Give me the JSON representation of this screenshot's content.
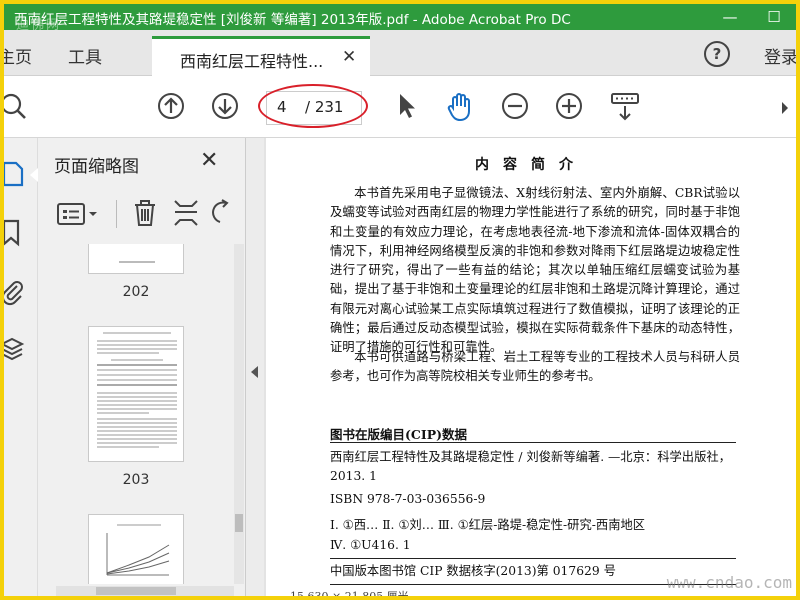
{
  "window": {
    "title": "西南红层工程特性及其路堤稳定性 [刘俊新 等编著] 2013年版.pdf - Adobe Acrobat Pro DC",
    "watermark": "迪佛网",
    "minimize": "—",
    "maximize": "☐"
  },
  "menu": {
    "home": "主页",
    "tools": "工具",
    "tab_label": "西南红层工程特性...",
    "tab_close": "✕",
    "help": "?",
    "sign_in": "登录"
  },
  "toolbar": {
    "page_current": "4",
    "page_total": "/ 231"
  },
  "thumbs": {
    "title": "页面缩略图",
    "close": "✕",
    "pages": [
      "202",
      "203"
    ]
  },
  "document": {
    "heading": "内容简介",
    "paragraph1": "本书首先采用电子显微镜法、X射线衍射法、室内外崩解、CBR试验以及蠕变等试验对西南红层的物理力学性能进行了系统的研究，同时基于非饱和土变量的有效应力理论，在考虑地表径流-地下渗流和流体-固体双耦合的情况下，利用神经网络模型反演的非饱和参数对降雨下红层路堤边坡稳定性进行了研究，得出了一些有益的结论；其次以单轴压缩红层蠕变试验为基础，提出了基于非饱和土变量理论的红层非饱和土路堤沉降计算理论，通过有限元对离心试验某工点实际填筑过程进行了数值模拟，证明了该理论的正确性；最后通过反动态模型试验，模拟在实际荷载条件下基床的动态特性，证明了措施的可行性和可靠性。",
    "paragraph2": "本书可供道路与桥梁工程、岩土工程等专业的工程技术人员与科研人员参考，也可作为高等院校相关专业师生的参考书。",
    "cip_title": "图书在版编目(CIP)数据",
    "cip_line1": "西南红层工程特性及其路堤稳定性 / 刘俊新等编著. —北京：科学出版社，2013. 1",
    "isbn": "ISBN 978-7-03-036556-9",
    "class_line1": "Ⅰ. ①西…    Ⅱ. ①刘…    Ⅲ. ①红层-路堤-稳定性-研究-西南地区",
    "class_line2": "Ⅳ. ①U416. 1",
    "cip_number": "中国版本图书馆 CIP 数据核字(2013)第 017629 号",
    "status_fragment": "15.630 × 21.805 厘米"
  },
  "site_watermark": "www.cndao.com"
}
